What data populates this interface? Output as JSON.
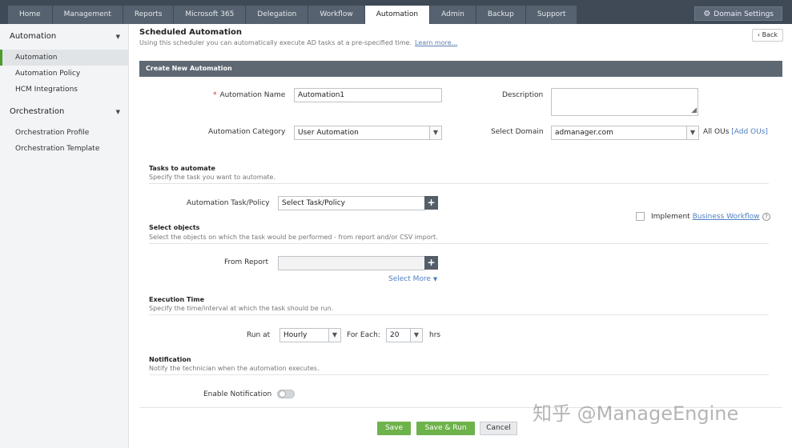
{
  "nav": {
    "tabs": [
      "Home",
      "Management",
      "Reports",
      "Microsoft 365",
      "Delegation",
      "Workflow",
      "Automation",
      "Admin",
      "Backup",
      "Support"
    ],
    "active_tab": "Automation",
    "domain_settings_label": "Domain Settings"
  },
  "sidebar": {
    "section_automation": "Automation",
    "items_automation": [
      "Automation",
      "Automation Policy",
      "HCM Integrations"
    ],
    "section_orchestration": "Orchestration",
    "items_orchestration": [
      "Orchestration Profile",
      "Orchestration Template"
    ]
  },
  "page": {
    "title": "Scheduled Automation",
    "subtitle": "Using this scheduler you can automatically execute AD tasks at a pre-specified time.",
    "learn_more": "Learn more...",
    "back_label": "Back",
    "panel_title": "Create New Automation"
  },
  "form": {
    "automation_name_label": "Automation Name",
    "automation_name_value": "Automation1",
    "description_label": "Description",
    "category_label": "Automation Category",
    "category_value": "User Automation",
    "domain_label": "Select Domain",
    "domain_value": "admanager.com",
    "all_ous": "All OUs",
    "add_ous": "[Add OUs]",
    "tasks_title": "Tasks to automate",
    "tasks_desc": "Specify the task you want to automate.",
    "task_policy_label": "Automation Task/Policy",
    "task_policy_value": "Select Task/Policy",
    "implement_label": "Implement",
    "business_workflow": "Business Workflow",
    "objects_title": "Select objects",
    "objects_desc": "Select the objects on which the task would be performed - from report and/or CSV import.",
    "from_report_label": "From Report",
    "from_report_value": "",
    "select_more": "Select More",
    "exec_title": "Execution Time",
    "exec_desc": "Specify the time/interval at which the task should be run.",
    "run_at_label": "Run at",
    "run_at_value": "Hourly",
    "for_each_label": "For Each:",
    "for_each_value": "20",
    "hrs_label": "hrs",
    "notify_title": "Notification",
    "notify_desc": "Notify the technician when the automation executes.",
    "enable_notify_label": "Enable Notification"
  },
  "buttons": {
    "save": "Save",
    "save_run": "Save & Run",
    "cancel": "Cancel"
  },
  "watermark": "知乎 @ManageEngine",
  "colors": {
    "nav_bg": "#3f4a56",
    "panel_header": "#5e6873",
    "accent_green": "#6eb24b",
    "link": "#4f7fbf",
    "required": "#d0302c"
  }
}
